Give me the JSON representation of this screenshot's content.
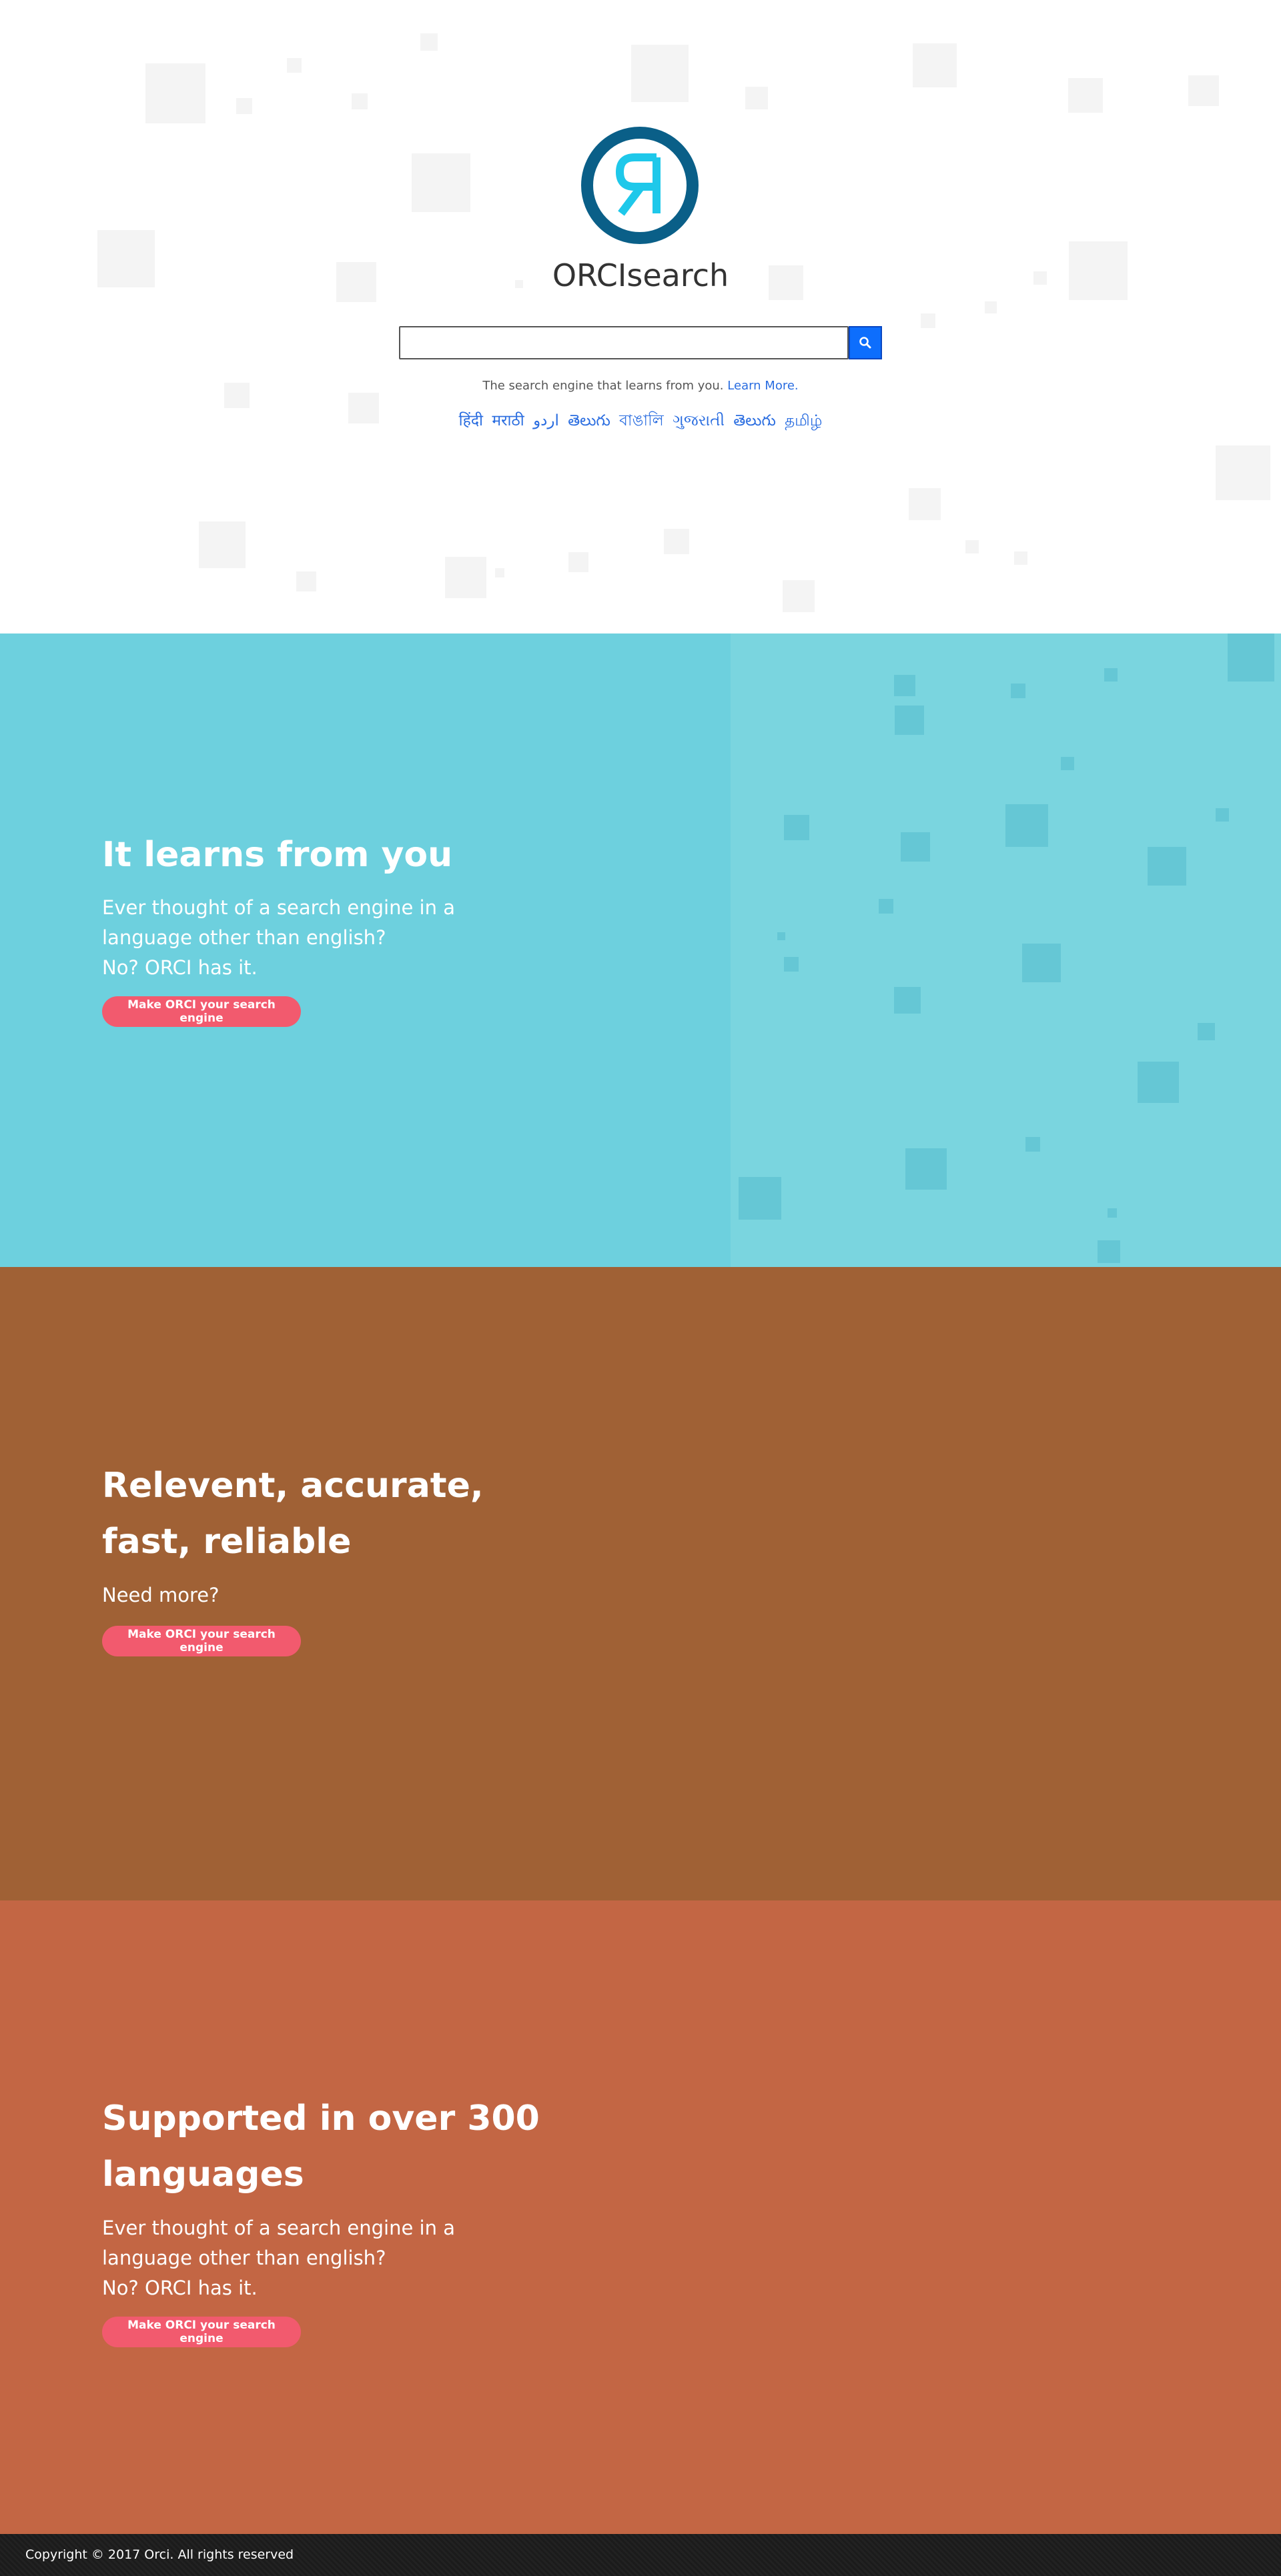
{
  "hero": {
    "brand": "ORCIsearch",
    "search": {
      "value": "",
      "placeholder": ""
    },
    "search_icon": "search-icon",
    "tagline_text": "The search engine that learns from you.",
    "learn_more": "Learn More.",
    "languages": [
      "हिंदी",
      "मराठी",
      "اردو",
      "తెలుగు",
      "বাঙালি",
      "ગુજરાતી",
      "తెలుగు",
      "தமிழ்"
    ]
  },
  "sections": [
    {
      "title_line1": "It learns from you",
      "title_line2": "",
      "text_line1": "Ever thought of a search engine in a",
      "text_line2": "language other than english?",
      "text_line3": "No? ORCI has it.",
      "button": "Make ORCI your search engine"
    },
    {
      "title_line1": "Relevent, accurate,",
      "title_line2": "fast, reliable",
      "text_line1": "Need more?",
      "button": "Make ORCI your search engine"
    },
    {
      "title_line1": "Supported in over 300",
      "title_line2": "languages",
      "text_line1": "Ever thought of a search engine in a",
      "text_line2": "language other than english?",
      "text_line3": "No? ORCI has it.",
      "button": "Make ORCI your search engine"
    }
  ],
  "footer": {
    "copyright": "Copyright © 2017 Orci. All rights reserved"
  },
  "colors": {
    "logo_ring": "#0a5f88",
    "logo_glyph": "#1ec8ea",
    "search_button": "#0d6efd",
    "link": "#2a6de0",
    "section1_bg": "#6dd0de",
    "section2_bg": "#a06135",
    "section3_bg": "#c36644",
    "cta_bg": "#f25a6e",
    "footer_bg": "#1e1e1e"
  }
}
